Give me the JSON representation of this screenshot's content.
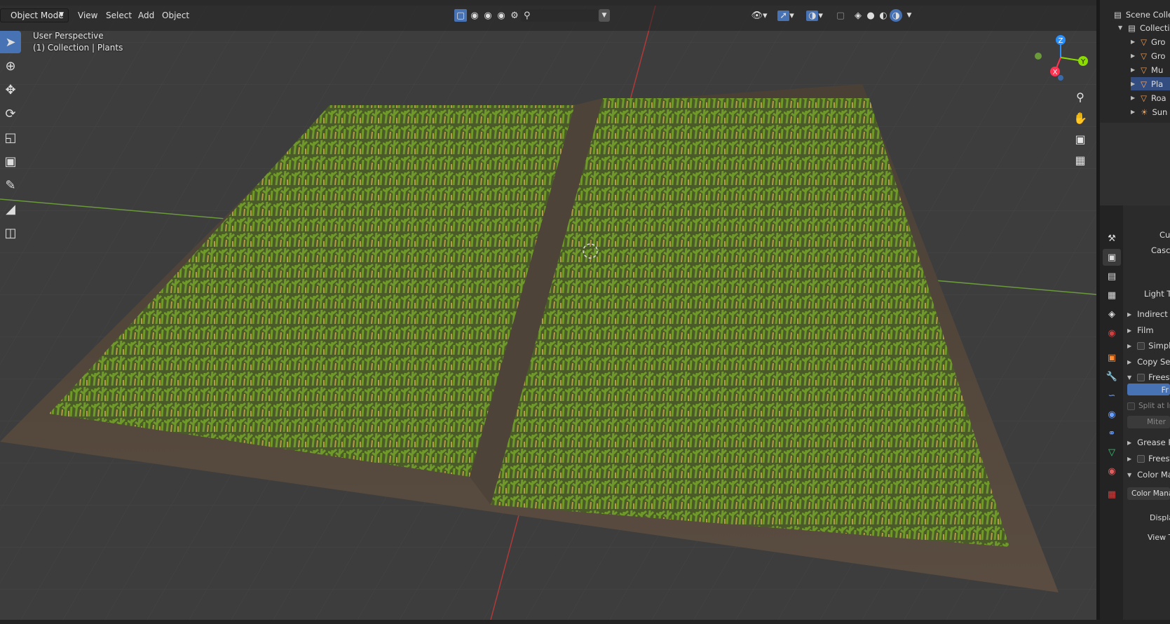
{
  "header": {
    "mode": "Object Mode",
    "menus": [
      "View",
      "Select",
      "Add",
      "Object"
    ]
  },
  "viewport": {
    "perspective": "User Perspective",
    "collection": "(1) Collection | Plants"
  },
  "gizmo": {
    "z": "Z",
    "y": "Y",
    "x": "X"
  },
  "outliner": {
    "scene": "Scene Colle",
    "collection": "Collecti",
    "items": [
      "Gro",
      "Gro",
      "Mu",
      "Pla",
      "Roa",
      "Sun"
    ]
  },
  "properties": {
    "rows": {
      "cu": "Cu",
      "cascade": "Cascad",
      "light_threshold": "Light Th",
      "indirect": "Indirect L",
      "film": "Film",
      "simplify": "Simplif",
      "copy_settings": "Copy Set",
      "freestyle": "Freest",
      "freestyle_btn": "Fr",
      "split": "Split at In",
      "miter": "Miter",
      "grease": "Grease P",
      "freestyle2": "Freest",
      "color_man": "Color Mar",
      "color_manage_btn": "Color Mana",
      "display": "Displa",
      "view": "View T"
    }
  },
  "colors": {
    "accent": "#4772b3",
    "viewport_bg": "#3d3d3d",
    "x_axis": "#ff3352",
    "y_axis": "#8bdc00",
    "z_axis": "#2890ff"
  }
}
